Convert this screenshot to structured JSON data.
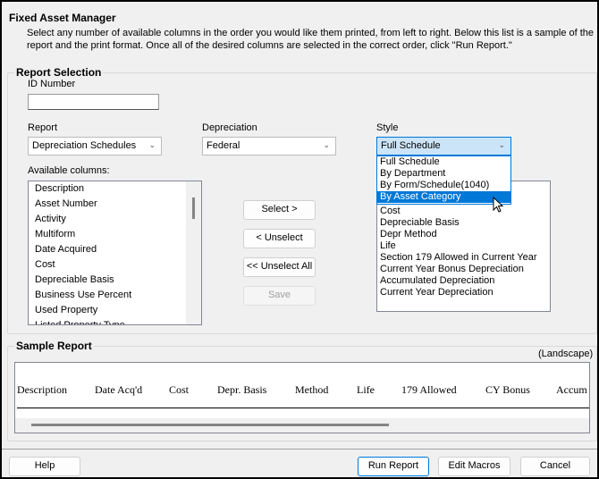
{
  "title": "Fixed Asset Manager",
  "description": "Select any number of available columns in the order you would like them printed, from left to right. Below this list is a sample of the report and the print format. Once all of the desired columns are selected in the correct order, click \"Run Report.\"",
  "report_selection": {
    "label": "Report Selection",
    "id_label": "ID Number",
    "id_value": "",
    "report_label": "Report",
    "report_value": "Depreciation Schedules",
    "depreciation_label": "Depreciation",
    "depreciation_value": "Federal",
    "style_label": "Style",
    "style_value": "Full Schedule",
    "style_options": [
      "Full Schedule",
      "By Department",
      "By Form/Schedule(1040)",
      "By Asset Category"
    ],
    "style_highlighted": "By Asset Category",
    "available_label": "Available columns:",
    "available": [
      "Description",
      "Asset Number",
      "Activity",
      "Multiform",
      "Date Acquired",
      "Cost",
      "Depreciable Basis",
      "Business Use Percent",
      "Used Property",
      "Listed Property Type"
    ],
    "selected": [
      "Cost",
      "Depreciable Basis",
      "Depr Method",
      "Life",
      "Section 179 Allowed in Current Year",
      "Current Year Bonus Depreciation",
      "Accumulated Depreciation",
      "Current Year Depreciation"
    ],
    "buttons": {
      "select": "Select >",
      "unselect": "< Unselect",
      "unselect_all": "<< Unselect All",
      "save": "Save"
    }
  },
  "sample": {
    "label": "Sample Report",
    "orientation": "(Landscape)",
    "columns": [
      "Description",
      "Date Acq'd",
      "Cost",
      "Depr. Basis",
      "Method",
      "Life",
      "179 Allowed",
      "CY Bonus",
      "Accum D"
    ]
  },
  "footer": {
    "help": "Help",
    "run": "Run Report",
    "macros": "Edit Macros",
    "cancel": "Cancel"
  }
}
